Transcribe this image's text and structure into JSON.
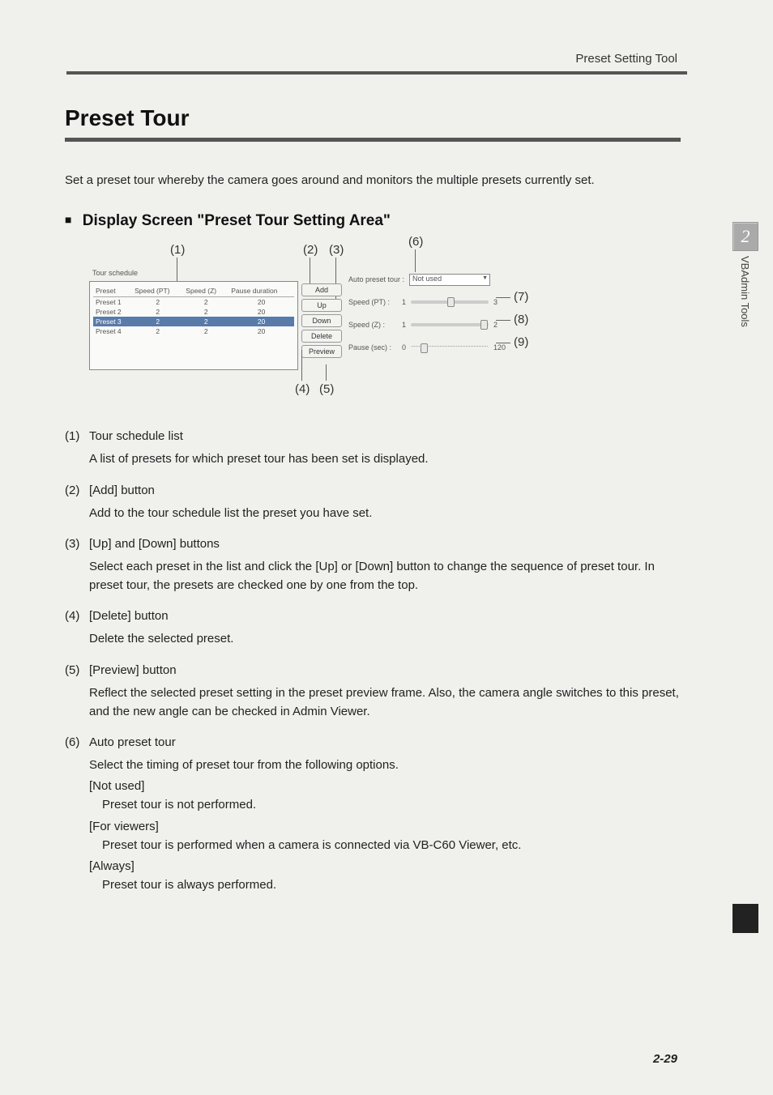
{
  "header": {
    "section": "Preset Setting Tool"
  },
  "title": "Preset Tour",
  "intro": "Set a preset tour whereby the camera goes around and monitors the multiple presets currently set.",
  "subheading": "Display Screen \"Preset Tour Setting Area\"",
  "callouts": {
    "c1": "(1)",
    "c2": "(2)",
    "c3": "(3)",
    "c4": "(4)",
    "c5": "(5)",
    "c6": "(6)",
    "c7": "(7)",
    "c8": "(8)",
    "c9": "(9)"
  },
  "tour_schedule": {
    "label": "Tour schedule",
    "headers": {
      "preset": "Preset",
      "speed_pt": "Speed (PT)",
      "speed_z": "Speed (Z)",
      "pause": "Pause duration"
    },
    "rows": [
      {
        "preset": "Preset 1",
        "spt": "2",
        "sz": "2",
        "pd": "20",
        "sel": false
      },
      {
        "preset": "Preset 2",
        "spt": "2",
        "sz": "2",
        "pd": "20",
        "sel": false
      },
      {
        "preset": "Preset 3",
        "spt": "2",
        "sz": "2",
        "pd": "20",
        "sel": true
      },
      {
        "preset": "Preset 4",
        "spt": "2",
        "sz": "2",
        "pd": "20",
        "sel": false
      }
    ]
  },
  "buttons": {
    "add": "Add",
    "up": "Up",
    "down": "Down",
    "delete": "Delete",
    "preview": "Preview"
  },
  "right_panel": {
    "auto_label": "Auto preset tour :",
    "auto_value": "Not used",
    "speed_pt_label": "Speed (PT) :",
    "speed_pt_min": "1",
    "speed_pt_max": "3",
    "speed_z_label": "Speed (Z) :",
    "speed_z_min": "1",
    "speed_z_max": "2",
    "pause_label": "Pause (sec) :",
    "pause_min": "0",
    "pause_max": "120"
  },
  "descriptions": [
    {
      "num": "(1)",
      "title": "Tour schedule list",
      "body": "A list of presets for which preset tour has been set is displayed."
    },
    {
      "num": "(2)",
      "title": "[Add] button",
      "body": "Add to the tour schedule list the preset you have set."
    },
    {
      "num": "(3)",
      "title": "[Up] and [Down] buttons",
      "body": "Select each preset in the list and click the [Up] or [Down] button to change the sequence of preset tour. In preset tour, the presets are checked one by one from the top."
    },
    {
      "num": "(4)",
      "title": "[Delete] button",
      "body": "Delete the selected preset."
    },
    {
      "num": "(5)",
      "title": "[Preview] button",
      "body": "Reflect the selected preset setting in the preset preview frame. Also, the camera angle switches to this preset, and the new angle can be checked in Admin Viewer."
    },
    {
      "num": "(6)",
      "title": "Auto preset tour",
      "body": "Select the timing of preset tour from the following options.",
      "options": [
        {
          "t": "[Not used]",
          "b": "Preset tour is not performed."
        },
        {
          "t": "[For viewers]",
          "b": "Preset tour is performed when a camera is connected via VB-C60 Viewer, etc."
        },
        {
          "t": "[Always]",
          "b": "Preset tour is always performed."
        }
      ]
    }
  ],
  "sidebar": {
    "chapter": "2",
    "label": "VBAdmin Tools"
  },
  "page_number": "2-29"
}
